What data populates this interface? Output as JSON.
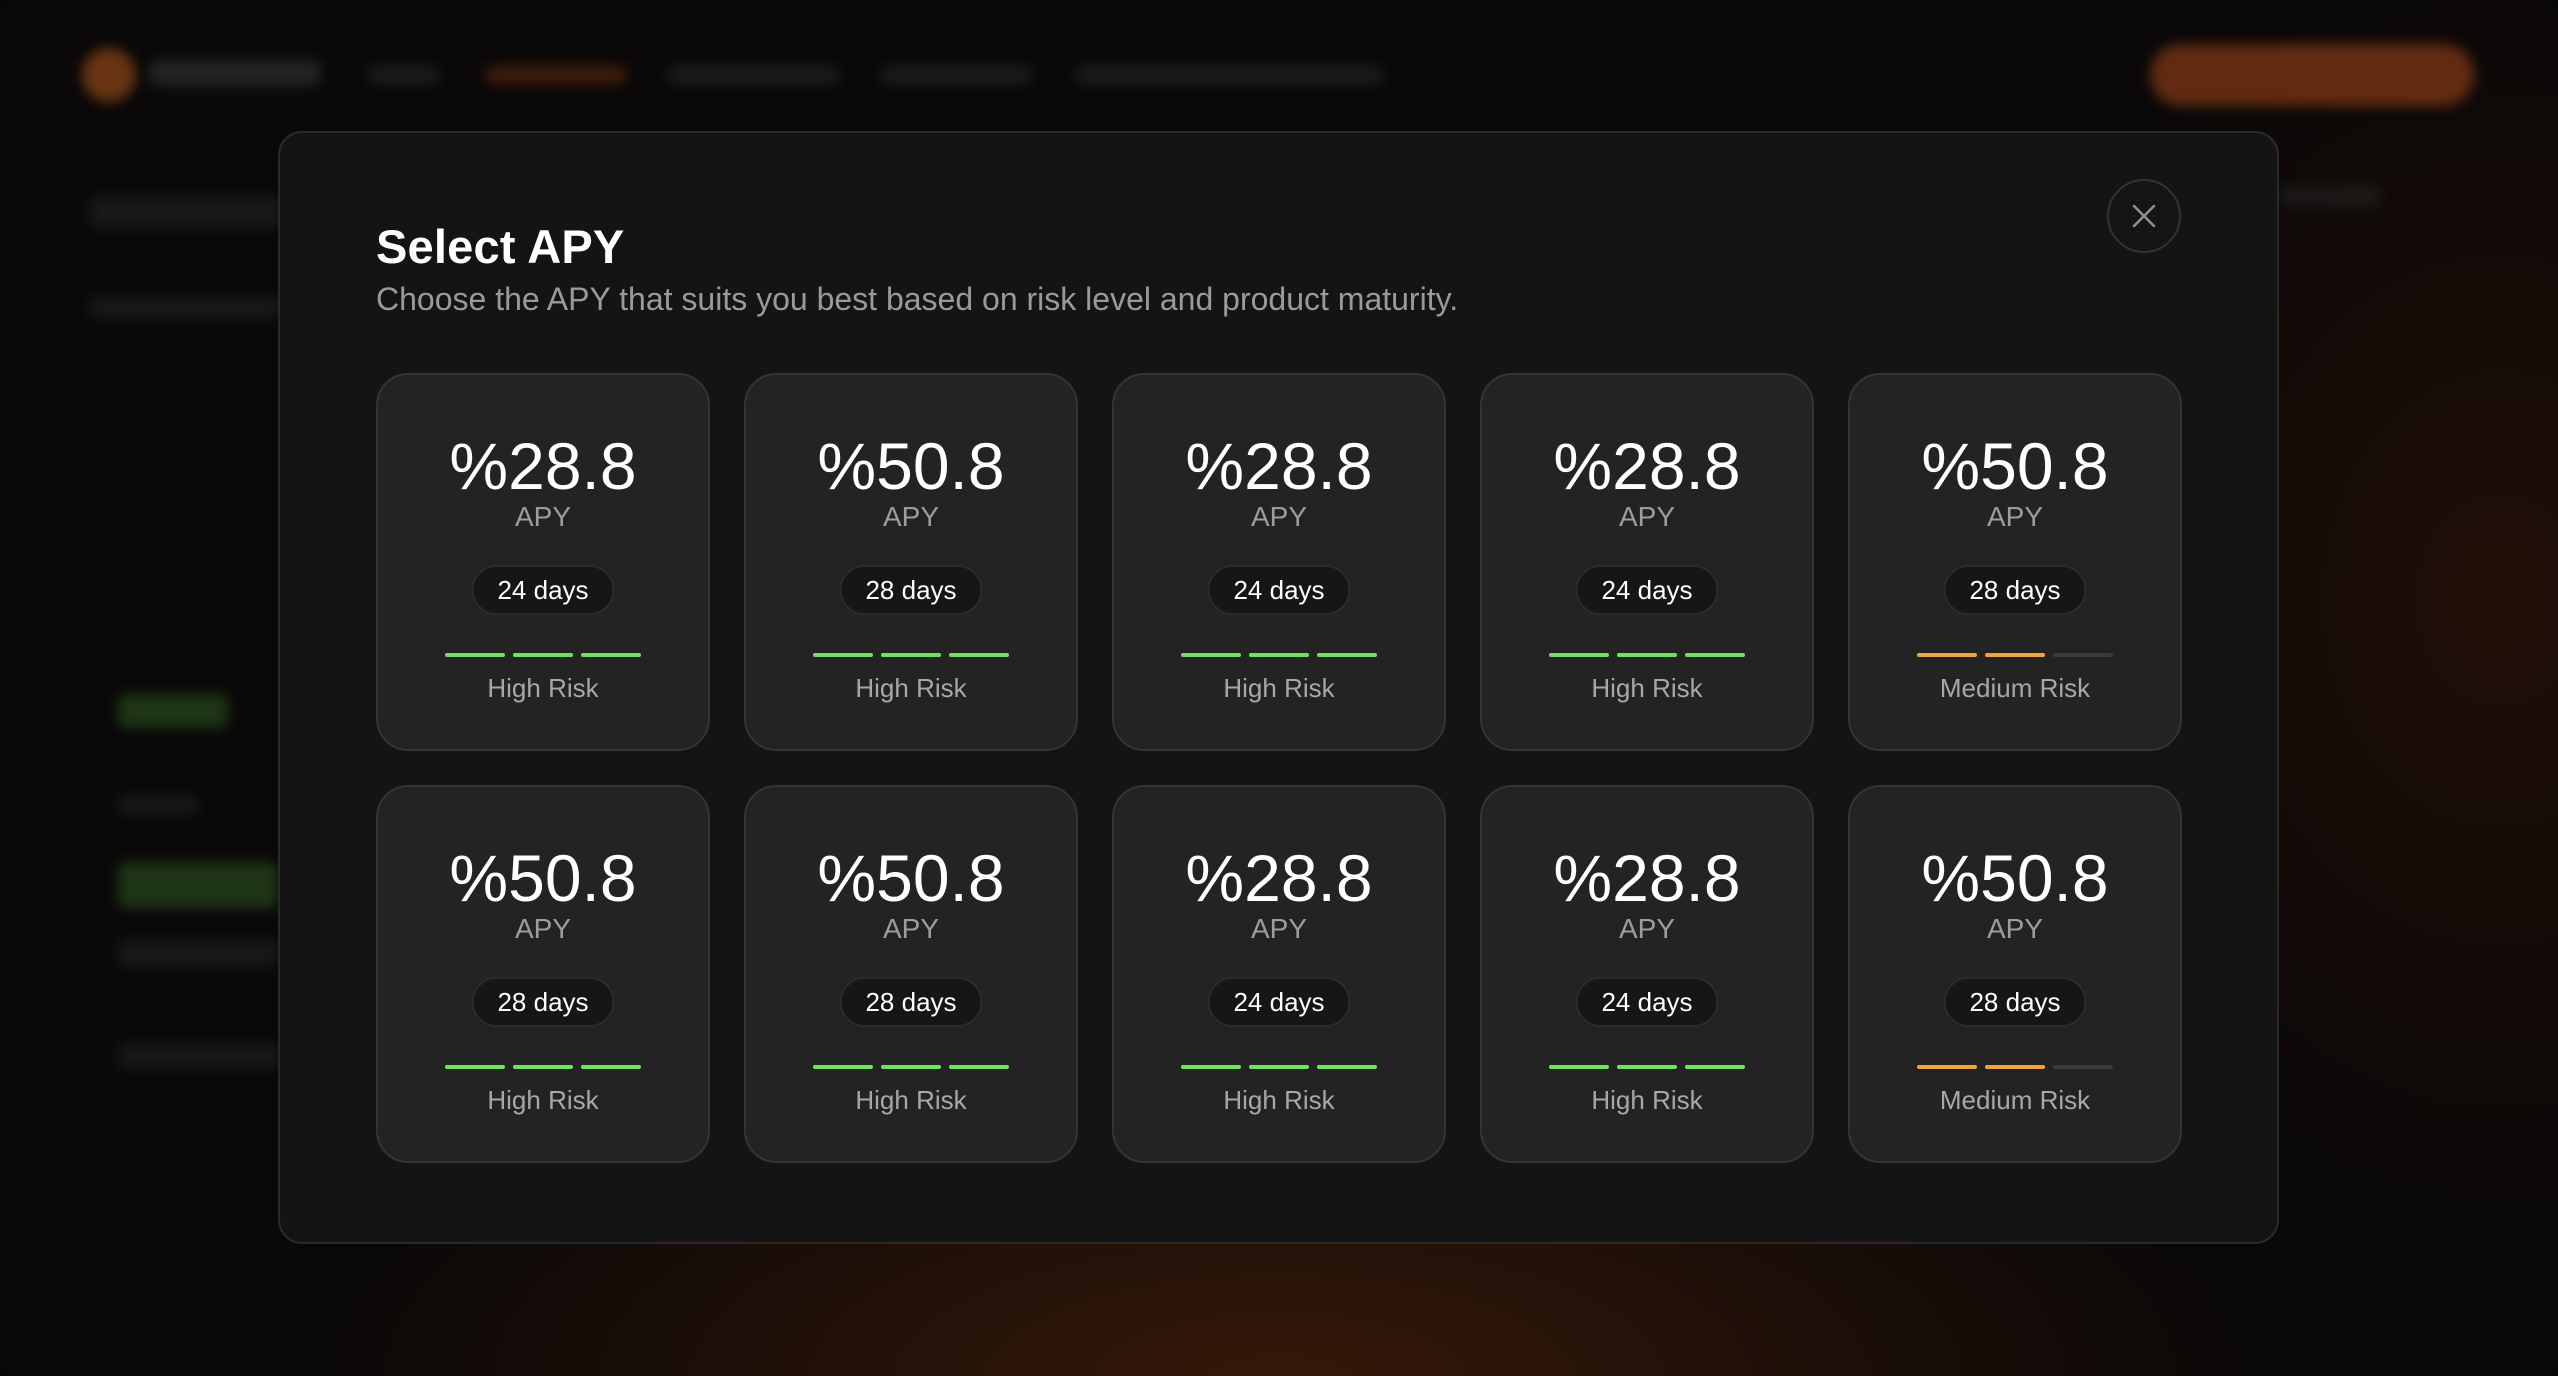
{
  "modal": {
    "title": "Select APY",
    "subtitle": "Choose the APY that suits you best based on risk level and product maturity.",
    "close_icon": "close-icon"
  },
  "colors": {
    "high_risk": "#6fe35a",
    "medium_risk": "#f0a53a",
    "inactive_bar": "#3a3a3a"
  },
  "options": [
    {
      "apy": "%28.8",
      "apy_label": "APY",
      "days": "24 days",
      "risk": "High Risk",
      "risk_level": 3,
      "risk_color": "#6fe35a"
    },
    {
      "apy": "%50.8",
      "apy_label": "APY",
      "days": "28 days",
      "risk": "High Risk",
      "risk_level": 3,
      "risk_color": "#6fe35a"
    },
    {
      "apy": "%28.8",
      "apy_label": "APY",
      "days": "24 days",
      "risk": "High Risk",
      "risk_level": 3,
      "risk_color": "#6fe35a"
    },
    {
      "apy": "%28.8",
      "apy_label": "APY",
      "days": "24 days",
      "risk": "High Risk",
      "risk_level": 3,
      "risk_color": "#6fe35a"
    },
    {
      "apy": "%50.8",
      "apy_label": "APY",
      "days": "28 days",
      "risk": "Medium Risk",
      "risk_level": 2,
      "risk_color": "#f0a53a"
    },
    {
      "apy": "%50.8",
      "apy_label": "APY",
      "days": "28 days",
      "risk": "High Risk",
      "risk_level": 3,
      "risk_color": "#6fe35a"
    },
    {
      "apy": "%50.8",
      "apy_label": "APY",
      "days": "28 days",
      "risk": "High Risk",
      "risk_level": 3,
      "risk_color": "#6fe35a"
    },
    {
      "apy": "%28.8",
      "apy_label": "APY",
      "days": "24 days",
      "risk": "High Risk",
      "risk_level": 3,
      "risk_color": "#6fe35a"
    },
    {
      "apy": "%28.8",
      "apy_label": "APY",
      "days": "24 days",
      "risk": "High Risk",
      "risk_level": 3,
      "risk_color": "#6fe35a"
    },
    {
      "apy": "%50.8",
      "apy_label": "APY",
      "days": "28 days",
      "risk": "Medium Risk",
      "risk_level": 2,
      "risk_color": "#f0a53a"
    }
  ]
}
